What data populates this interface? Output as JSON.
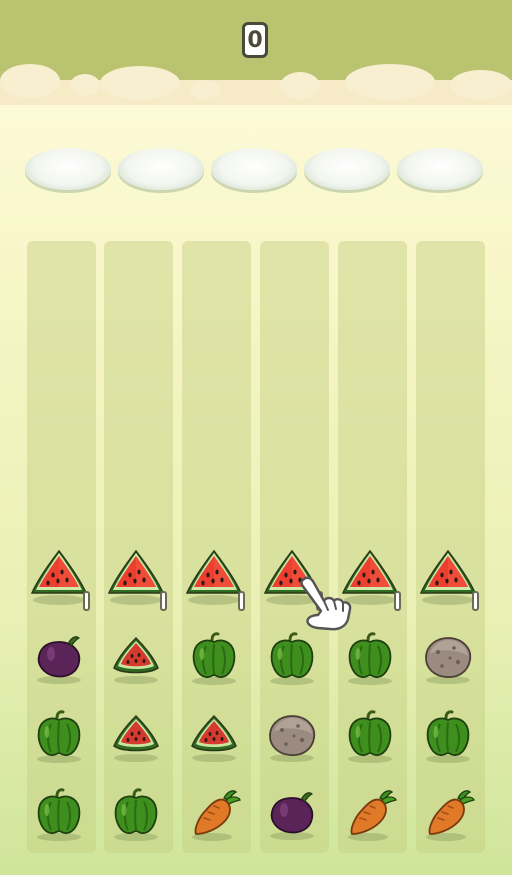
{
  "score": "0",
  "plates": [
    {
      "id": 1,
      "item": ""
    },
    {
      "id": 2,
      "item": ""
    },
    {
      "id": 3,
      "item": ""
    },
    {
      "id": 4,
      "item": ""
    },
    {
      "id": 5,
      "item": ""
    }
  ],
  "columns": [
    [
      "watermelon",
      "eggplant",
      "pepper",
      "pepper"
    ],
    [
      "watermelon",
      "watermelon-slice",
      "watermelon-slice",
      "pepper"
    ],
    [
      "watermelon",
      "pepper",
      "watermelon-slice",
      "carrot"
    ],
    [
      "watermelon",
      "pepper",
      "potato",
      "eggplant"
    ],
    [
      "watermelon",
      "pepper",
      "pepper",
      "carrot"
    ],
    [
      "watermelon",
      "potato",
      "pepper",
      "carrot"
    ]
  ],
  "tap_hint_icon": "pointing-hand-icon"
}
